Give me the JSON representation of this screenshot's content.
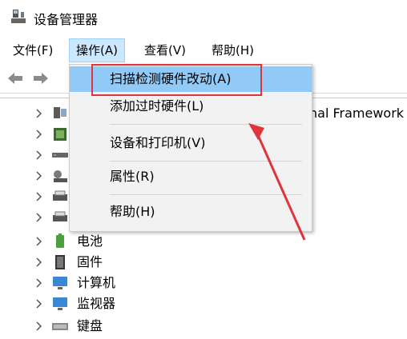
{
  "window": {
    "title": "设备管理器"
  },
  "menu": {
    "file": "文件(F)",
    "action": "操作(A)",
    "view": "查看(V)",
    "help": "帮助(H)"
  },
  "dropdown": {
    "items": [
      {
        "label": "扫描检测硬件改动(A)"
      },
      {
        "label": "添加过时硬件(L)"
      },
      {
        "label": "设备和打印机(V)"
      },
      {
        "label": "属性(R)"
      },
      {
        "label": "帮助(H)"
      }
    ]
  },
  "tree": {
    "partial_label": "nal Framework",
    "items": [
      {
        "label": "",
        "icon": "computer-chip-icon"
      },
      {
        "label": "",
        "icon": "processor-icon"
      },
      {
        "label": "",
        "icon": "disk-drive-icon"
      },
      {
        "label": "",
        "icon": "storage-controller-icon"
      },
      {
        "label": "",
        "icon": "printer-icon"
      },
      {
        "label": "",
        "icon": "printer-queue-icon"
      },
      {
        "label": "电池",
        "icon": "battery-icon"
      },
      {
        "label": "固件",
        "icon": "firmware-icon"
      },
      {
        "label": "计算机",
        "icon": "computer-icon"
      },
      {
        "label": "监视器",
        "icon": "monitor-icon"
      },
      {
        "label": "键盘",
        "icon": "keyboard-icon"
      }
    ]
  },
  "colors": {
    "highlight": "#91c9f7",
    "annotation": "#e0343c",
    "menu_active": "#cce8ff"
  }
}
